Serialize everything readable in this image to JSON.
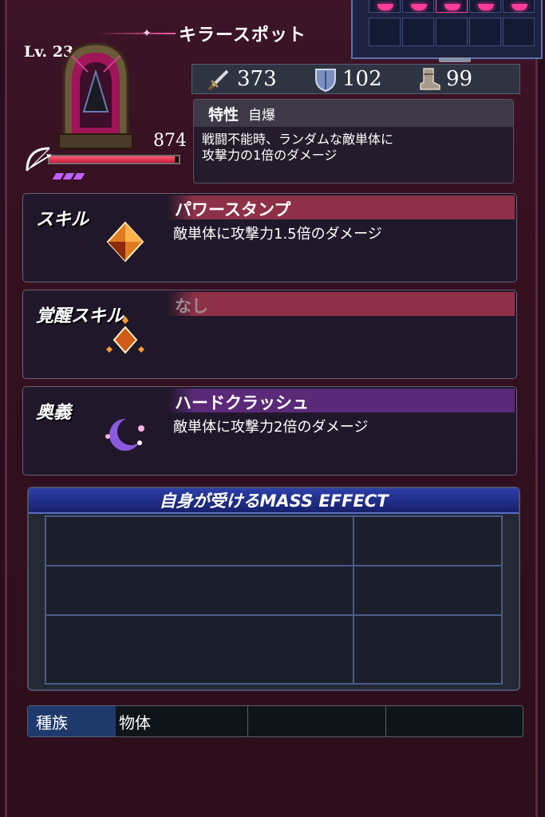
{
  "header": {
    "title": "キラースポット",
    "level": "Lv. 23"
  },
  "unit": {
    "hp": "874",
    "hp_fill": 0.97,
    "sp_bars": 3
  },
  "stats": {
    "attack": "373",
    "defense": "102",
    "speed": "99"
  },
  "trait": {
    "label": "特性",
    "name": "自爆",
    "desc_line1": "戦闘不能時、ランダムな敵単体に",
    "desc_line2": "攻撃力の1倍のダメージ"
  },
  "skill": {
    "label": "スキル",
    "name": "パワースタンプ",
    "desc": "敵単体に攻撃力1.5倍のダメージ",
    "bar_color": "#8e3048"
  },
  "awaken": {
    "label": "覚醒スキル",
    "name": "なし",
    "bar_color": "#8e3048"
  },
  "ougi": {
    "label": "奥義",
    "name": "ハードクラッシュ",
    "desc": "敵単体に攻撃力2倍のダメージ",
    "bar_color": "#5a2a78"
  },
  "mass_effect": {
    "title": "自身が受けるMASS EFFECT"
  },
  "race": {
    "label": "種族",
    "value": "物体"
  },
  "colors": {
    "accent_pink": "#ff3c9a",
    "hp_red": "#e0284a",
    "sp_purple": "#c060ff"
  },
  "icons": {
    "attack": "sword-icon",
    "defense": "shield-icon",
    "speed": "boot-icon",
    "class": "bow-icon"
  }
}
